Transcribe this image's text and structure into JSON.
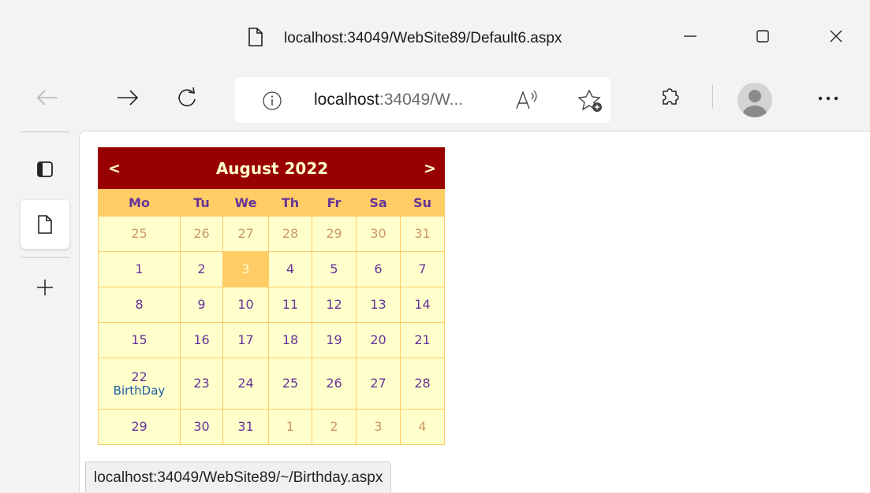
{
  "window": {
    "title": "localhost:34049/WebSite89/Default6.aspx",
    "controls": {
      "minimize_icon": "minimize-icon",
      "maximize_icon": "maximize-icon",
      "close_icon": "close-icon"
    }
  },
  "navbar": {
    "address_host": "localhost",
    "address_rest": ":34049/W...",
    "icons": [
      "back-arrow-icon",
      "forward-arrow-icon",
      "refresh-icon",
      "info-icon",
      "read-aloud-icon",
      "add-favorite-icon",
      "extensions-icon",
      "profile-avatar-icon",
      "more-icon"
    ]
  },
  "sidebar": {
    "icons": [
      "tab-actions-icon",
      "page-tab-icon",
      "new-tab-plus-icon"
    ]
  },
  "calendar": {
    "prev_label": "<",
    "next_label": ">",
    "title": "August 2022",
    "day_headers": [
      "Mo",
      "Tu",
      "We",
      "Th",
      "Fr",
      "Sa",
      "Su"
    ],
    "colors": {
      "title_bg": "#990000",
      "title_fg": "#ffffcc",
      "header_bg": "#ffcc66",
      "day_fg": "#663399",
      "other_month_fg": "#cc9966",
      "cell_bg": "#ffffcc",
      "today_bg": "#ffcc66",
      "event_link": "#1e5fa0"
    },
    "weeks": [
      [
        {
          "d": "25",
          "other": true
        },
        {
          "d": "26",
          "other": true
        },
        {
          "d": "27",
          "other": true
        },
        {
          "d": "28",
          "other": true
        },
        {
          "d": "29",
          "other": true
        },
        {
          "d": "30",
          "other": true
        },
        {
          "d": "31",
          "other": true
        }
      ],
      [
        {
          "d": "1"
        },
        {
          "d": "2"
        },
        {
          "d": "3",
          "today": true
        },
        {
          "d": "4"
        },
        {
          "d": "5"
        },
        {
          "d": "6"
        },
        {
          "d": "7"
        }
      ],
      [
        {
          "d": "8"
        },
        {
          "d": "9"
        },
        {
          "d": "10"
        },
        {
          "d": "11"
        },
        {
          "d": "12"
        },
        {
          "d": "13"
        },
        {
          "d": "14"
        }
      ],
      [
        {
          "d": "15"
        },
        {
          "d": "16"
        },
        {
          "d": "17"
        },
        {
          "d": "18"
        },
        {
          "d": "19"
        },
        {
          "d": "20"
        },
        {
          "d": "21"
        }
      ],
      [
        {
          "d": "22",
          "event": "BirthDay"
        },
        {
          "d": "23"
        },
        {
          "d": "24"
        },
        {
          "d": "25"
        },
        {
          "d": "26"
        },
        {
          "d": "27"
        },
        {
          "d": "28"
        }
      ],
      [
        {
          "d": "29"
        },
        {
          "d": "30"
        },
        {
          "d": "31"
        },
        {
          "d": "1",
          "other": true
        },
        {
          "d": "2",
          "other": true
        },
        {
          "d": "3",
          "other": true
        },
        {
          "d": "4",
          "other": true
        }
      ]
    ]
  },
  "status_bar": {
    "url": "localhost:34049/WebSite89/~/Birthday.aspx"
  }
}
